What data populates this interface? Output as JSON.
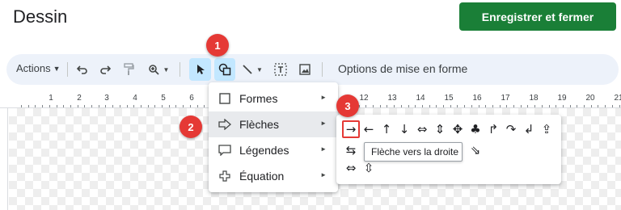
{
  "app": {
    "title": "Dessin",
    "save_label": "Enregistrer et fermer",
    "brand_color": "#1a7f37"
  },
  "toolbar": {
    "actions_label": "Actions",
    "options_label": "Options de mise en forme",
    "icons": [
      "undo-icon",
      "redo-icon",
      "paint-format-icon",
      "zoom-icon",
      "select-icon",
      "shape-icon",
      "line-icon",
      "text-box-icon",
      "image-icon"
    ]
  },
  "ruler": {
    "labels": [
      "1",
      "2",
      "3",
      "4",
      "5",
      "6",
      "12",
      "13",
      "14",
      "15",
      "16",
      "17",
      "18",
      "19",
      "20",
      "21"
    ]
  },
  "shapes_menu": {
    "items": [
      {
        "label": "Formes",
        "icon": "square-icon",
        "has_submenu": true
      },
      {
        "label": "Flèches",
        "icon": "arrow-right-icon",
        "has_submenu": true,
        "active": true
      },
      {
        "label": "Légendes",
        "icon": "callout-icon",
        "has_submenu": true
      },
      {
        "label": "Équation",
        "icon": "plus-icon",
        "has_submenu": true
      }
    ]
  },
  "arrows_submenu": {
    "row1": [
      "→",
      "←",
      "↑",
      "↓",
      "⇔",
      "⇕",
      "✥",
      "♣",
      "↱",
      "↷",
      "↲",
      "⇪"
    ],
    "row2": [
      "⇆",
      "⇨",
      "⇩",
      "⊏",
      "⇚",
      "⊐",
      "⇒",
      "⇘"
    ],
    "row3": [
      "⇔",
      "⇳"
    ],
    "highlighted_index": 0
  },
  "tooltip": {
    "text": "Flèche vers la droite"
  },
  "badges": [
    {
      "label": "1"
    },
    {
      "label": "2"
    },
    {
      "label": "3"
    }
  ],
  "badge_color": "#e53935"
}
